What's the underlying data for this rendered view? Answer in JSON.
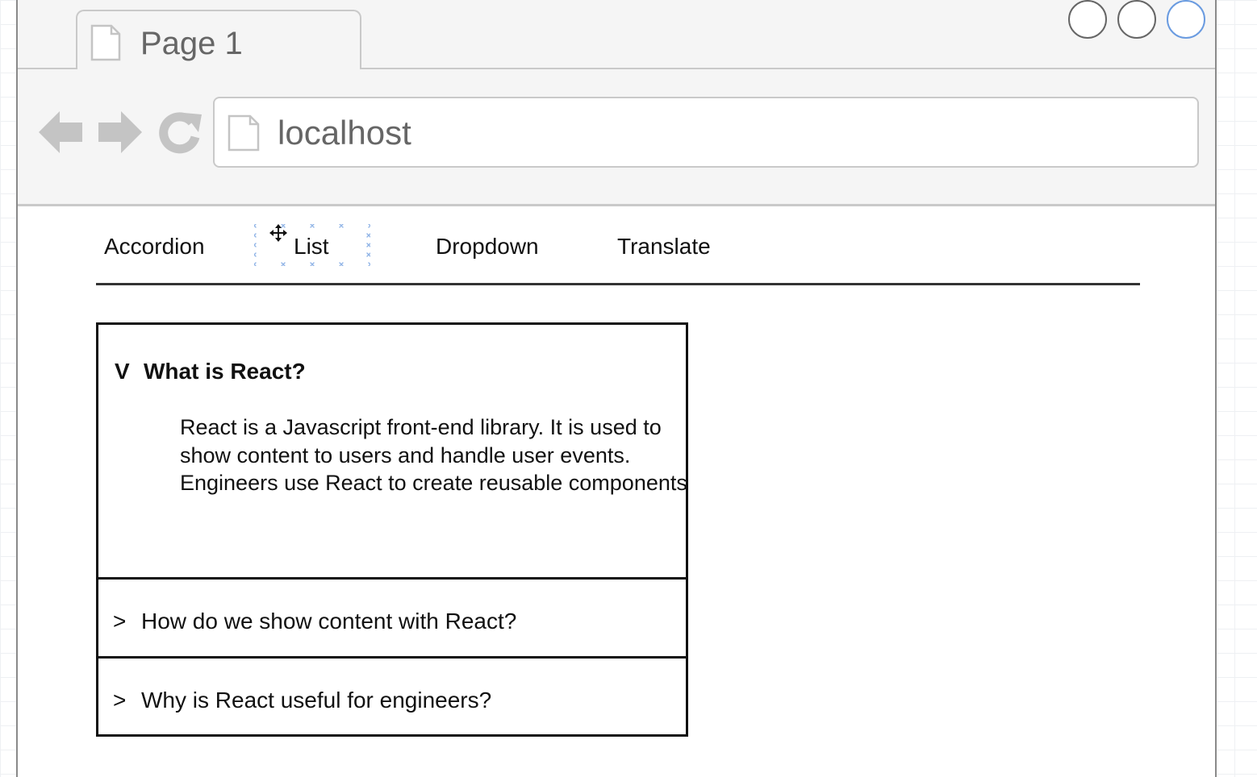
{
  "window": {
    "tab_title": "Page 1",
    "tab_icon": "page-icon",
    "controls": [
      "circle-control",
      "circle-control",
      "circle-control"
    ]
  },
  "toolbar": {
    "back_icon": "arrow-left-icon",
    "forward_icon": "arrow-right-icon",
    "reload_icon": "reload-icon",
    "url": "localhost",
    "url_icon": "page-icon"
  },
  "menu": {
    "items": [
      {
        "label": "Accordion"
      },
      {
        "label": "List",
        "selected": true
      },
      {
        "label": "Dropdown"
      },
      {
        "label": "Translate"
      }
    ]
  },
  "accordion": {
    "items": [
      {
        "marker": "V",
        "title": "What is React?",
        "expanded": true,
        "content": [
          "React is a Javascript front-end library. It is used to show content to users and handle user events.",
          "Engineers use React to create reusable components"
        ]
      },
      {
        "marker": ">",
        "title": "How do we show content with React?",
        "expanded": false
      },
      {
        "marker": ">",
        "title": "Why is React useful for engineers?",
        "expanded": false
      }
    ]
  },
  "colors": {
    "chrome_bg": "#f5f5f5",
    "chrome_border": "#c9c9c9",
    "icon_gray": "#c4c4c4",
    "selection_blue": "#6a9be0",
    "text": "#111111"
  }
}
